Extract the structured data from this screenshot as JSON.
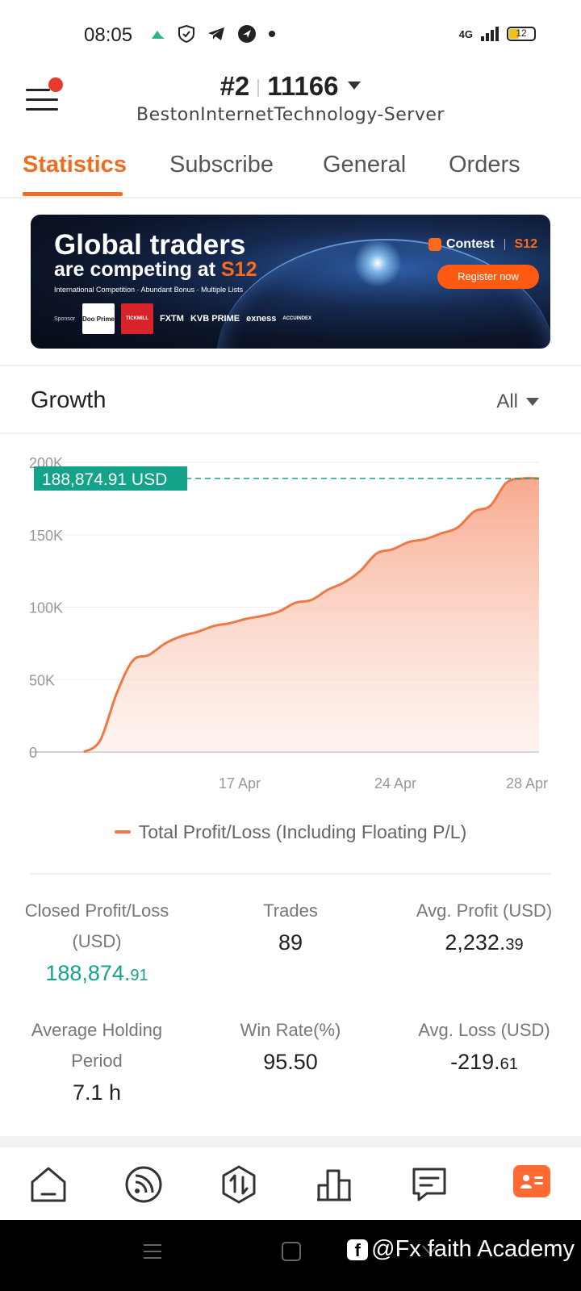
{
  "status_bar": {
    "time": "08:05",
    "network": "4G",
    "battery": "12",
    "icons": [
      "app-icon",
      "shield-icon",
      "telegram-icon",
      "app-circle-icon",
      "dot-icon",
      "signal-icon",
      "battery-icon"
    ]
  },
  "header": {
    "rank": "#2",
    "account": "11166",
    "server": "BestonInternetTechnology-Server"
  },
  "tabs": [
    {
      "label": "Statistics",
      "active": true
    },
    {
      "label": "Subscribe",
      "active": false
    },
    {
      "label": "General",
      "active": false
    },
    {
      "label": "Orders",
      "active": false
    }
  ],
  "banner": {
    "headline_1": "Global traders",
    "headline_2_prefix": "are competing at ",
    "headline_2_accent": "S12",
    "subtitle": "International Competition · Abundant Bonus · Multiple Lists",
    "sponsor_label": "Sponsor",
    "sponsors": [
      "Doo Prime",
      "TICKMILL",
      "FXTM",
      "KVB PRIME",
      "exness",
      "ACCUINDEX"
    ],
    "contest_label": "Contest",
    "contest_season": "S12",
    "cta": "Register now"
  },
  "growth": {
    "title": "Growth",
    "range": "All"
  },
  "chart_data": {
    "type": "area",
    "y_ticks": [
      "200K",
      "150K",
      "100K",
      "50K",
      "0"
    ],
    "x_ticks": [
      "17 Apr",
      "24 Apr",
      "28 Apr"
    ],
    "ylim": [
      0,
      200000
    ],
    "current_label": "188,874.91 USD",
    "current_value": 188874.91,
    "series": [
      {
        "name": "Total Profit/Loss (Including Floating P/L)",
        "color": "#ee7846",
        "values": [
          0,
          8000,
          40000,
          63000,
          67000,
          75000,
          80000,
          83000,
          87000,
          89000,
          92000,
          94000,
          97000,
          103000,
          105000,
          112000,
          117000,
          125000,
          137000,
          140000,
          145000,
          147000,
          151000,
          155000,
          166000,
          170000,
          186000,
          188874.91,
          188874.91
        ]
      }
    ],
    "legend_position": "bottom"
  },
  "stats": {
    "closed_pl_label": "Closed Profit/Loss (USD)",
    "closed_pl_int": "188,874.",
    "closed_pl_dec": "91",
    "trades_label": "Trades",
    "trades": "89",
    "avg_profit_label": "Avg. Profit (USD)",
    "avg_profit_int": "2,232.",
    "avg_profit_dec": "39",
    "avg_holding_label": "Average Holding Period",
    "avg_holding": "7.1 h",
    "win_rate_label": "Win Rate(%)",
    "win_rate": "95.50",
    "avg_loss_label": "Avg. Loss (USD)",
    "avg_loss_int": "-219.",
    "avg_loss_dec": "61"
  },
  "bottom_nav": [
    "home-icon",
    "feed-icon",
    "trade-icon",
    "chart-icon",
    "messages-icon",
    "profile-icon"
  ],
  "watermark": "@Fx faith Academy",
  "colors": {
    "accent": "#ee6d1f",
    "positive": "#14a28b",
    "chart_line": "#ee7846"
  }
}
